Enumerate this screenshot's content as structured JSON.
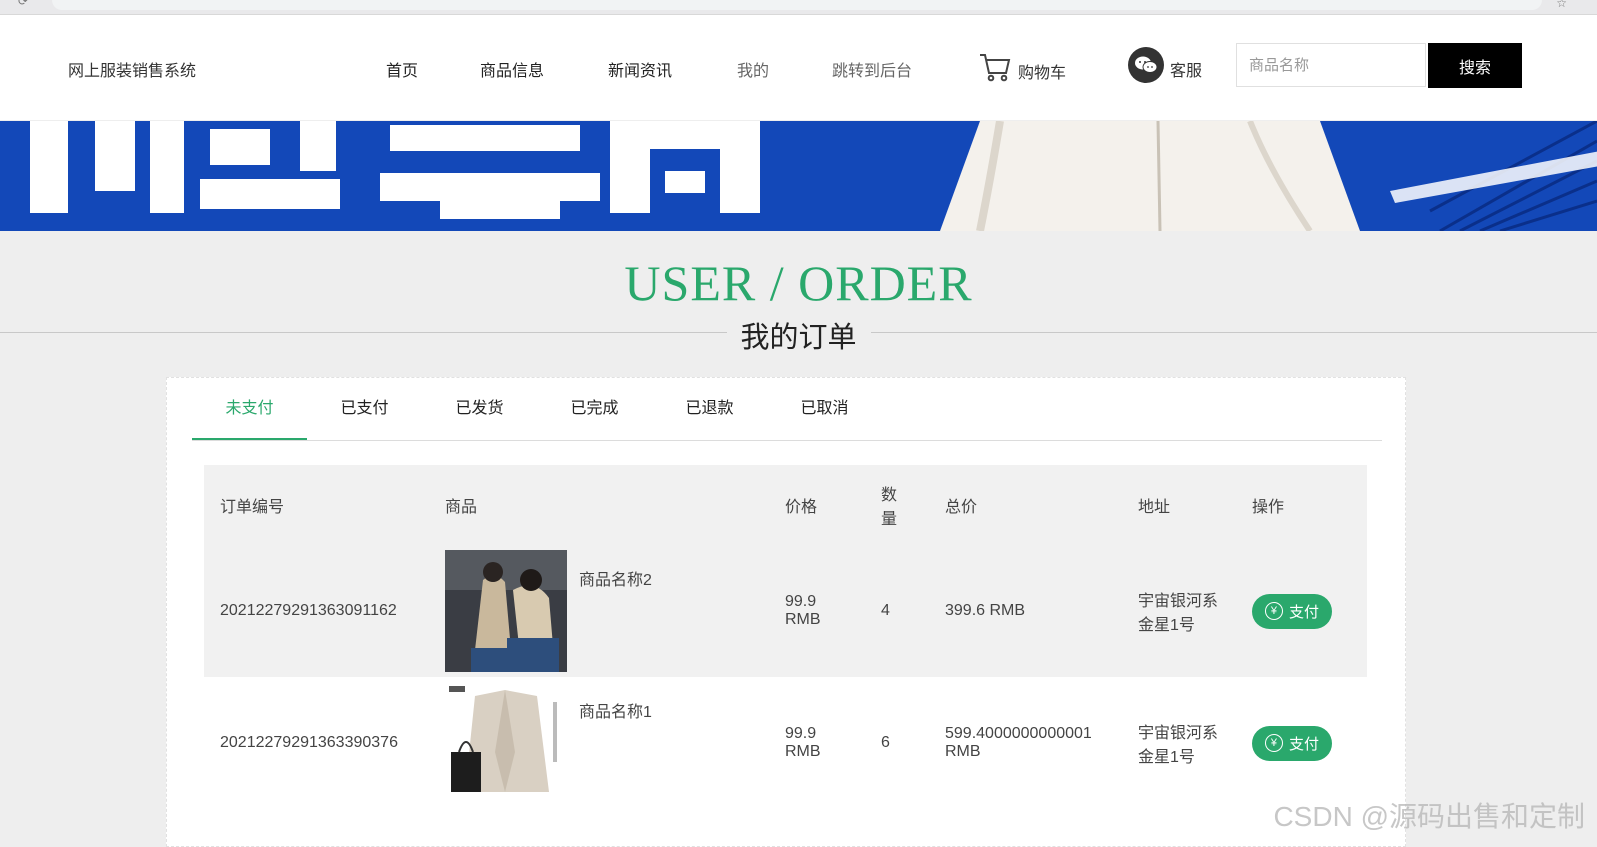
{
  "header": {
    "brand": "网上服装销售系统",
    "nav": [
      "首页",
      "商品信息",
      "新闻资讯",
      "我的",
      "跳转到后台"
    ],
    "cart_label": "购物车",
    "service_label": "客服",
    "search_placeholder": "商品名称",
    "search_button": "搜索"
  },
  "section": {
    "title": "USER / ORDER",
    "subtitle": "我的订单"
  },
  "tabs": [
    {
      "label": "未支付",
      "active": true
    },
    {
      "label": "已支付"
    },
    {
      "label": "已发货"
    },
    {
      "label": "已完成"
    },
    {
      "label": "已退款"
    },
    {
      "label": "已取消"
    }
  ],
  "table": {
    "headers": [
      "订单编号",
      "商品",
      "价格",
      "数量",
      "总价",
      "地址",
      "操作"
    ],
    "rows": [
      {
        "order_no": "20212279291363091162",
        "product": "商品名称2",
        "price": "99.9 RMB",
        "qty": "4",
        "total": "399.6 RMB",
        "address": "宇宙银河系金星1号",
        "action": "支付"
      },
      {
        "order_no": "20212279291363390376",
        "product": "商品名称1",
        "price": "99.9 RMB",
        "qty": "6",
        "total": "599.4000000000001 RMB",
        "address": "宇宙银河系金星1号",
        "action": "支付"
      }
    ]
  },
  "watermark": "CSDN @源码出售和定制",
  "colors": {
    "accent": "#2aa86c",
    "banner": "#1348b8"
  }
}
